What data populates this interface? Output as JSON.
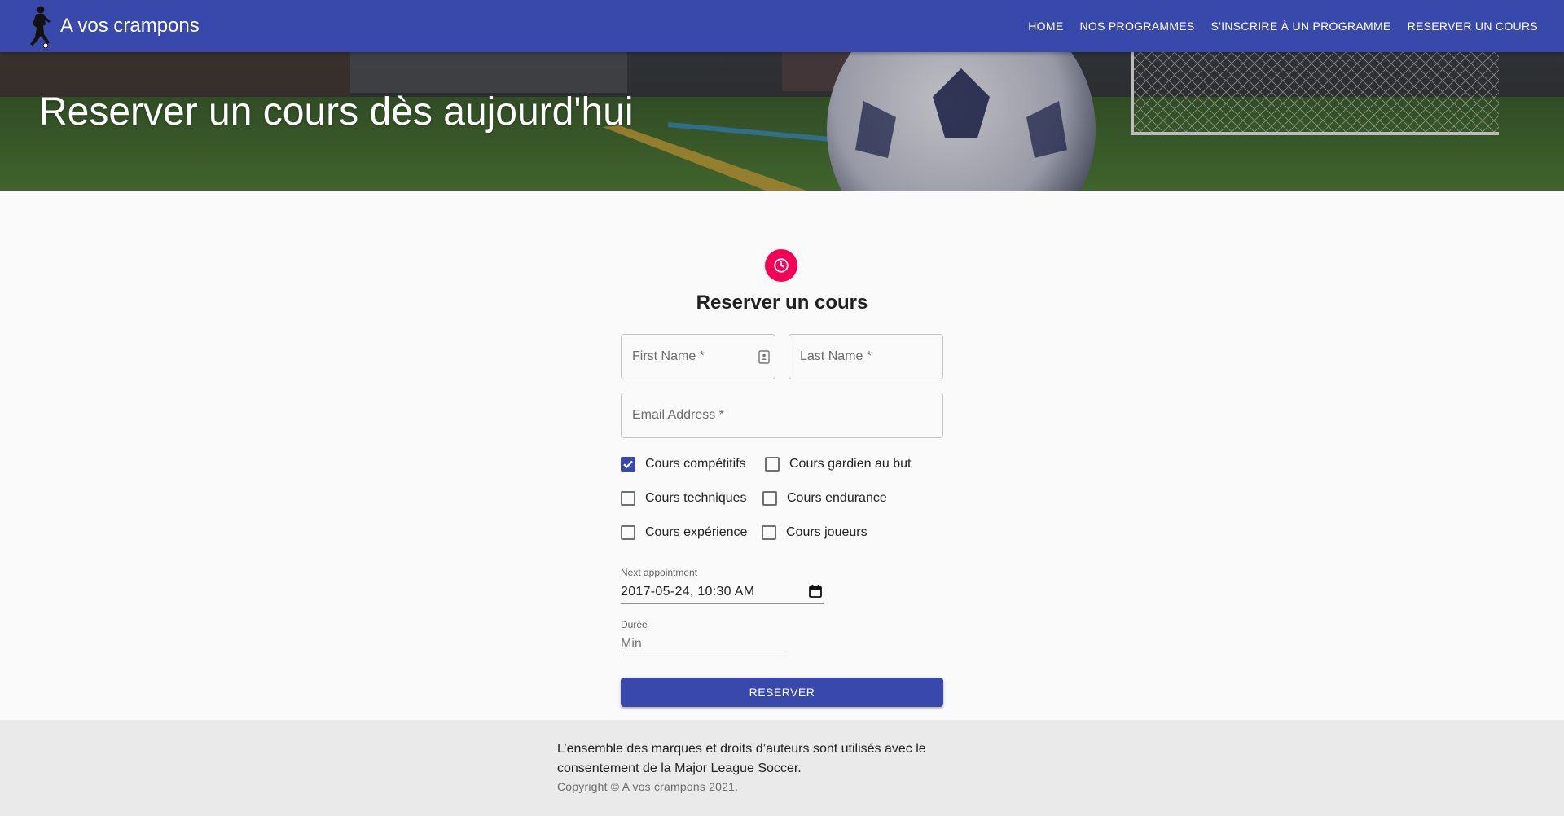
{
  "appbar": {
    "brand": "A vos crampons",
    "logo_icon": "soccer-player-icon",
    "nav": [
      {
        "label": "HOME"
      },
      {
        "label": "NOS PROGRAMMES"
      },
      {
        "label": "S'INSCRIRE À UN PROGRAMME"
      },
      {
        "label": "RESERVER UN COURS"
      }
    ],
    "color": "#3949ab"
  },
  "hero": {
    "title": "Reserver un cours dès aujourd'hui"
  },
  "form": {
    "icon": "clock-icon",
    "title": "Reserver un cours",
    "first_name_label": "First Name *",
    "last_name_label": "Last Name *",
    "email_label": "Email Address *",
    "courses": [
      {
        "label": "Cours compétitifs",
        "checked": true
      },
      {
        "label": "Cours gardien au but",
        "checked": false
      },
      {
        "label": "Cours techniques",
        "checked": false
      },
      {
        "label": "Cours endurance",
        "checked": false
      },
      {
        "label": "Cours expérience",
        "checked": false
      },
      {
        "label": "Cours joueurs",
        "checked": false
      }
    ],
    "appointment_label": "Next appointment",
    "appointment_value": "2017-05-24, 10:30  AM",
    "duration_label": "Durée",
    "duration_placeholder": "Min",
    "submit_label": "RESERVER",
    "accent": "#f50057"
  },
  "footer": {
    "legal": "L’ensemble des marques et droits d’auteurs sont utilisés avec le consentement de la Major League Soccer.",
    "copyright_prefix": "Copyright © ",
    "copyright_link": "A vos crampons",
    "copyright_suffix": " 2021."
  }
}
